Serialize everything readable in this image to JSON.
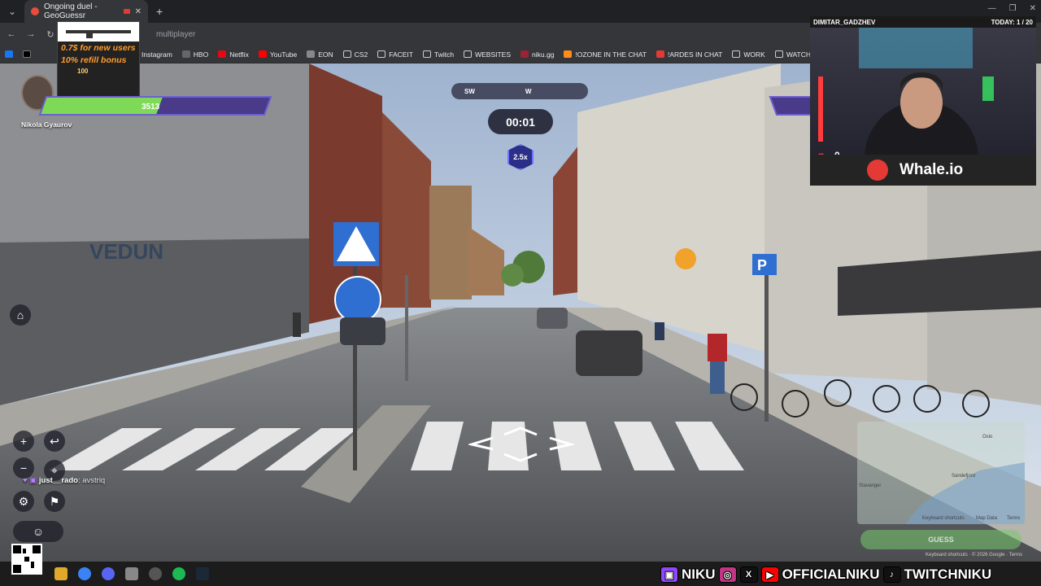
{
  "browser": {
    "tab_title": "Ongoing duel - GeoGuessr",
    "url_fragment": "multiplayer",
    "bookmarks": [
      {
        "label": "Instagram",
        "color": "#c13584"
      },
      {
        "label": "HBO",
        "color": "#666666"
      },
      {
        "label": "Netflix",
        "color": "#e50914"
      },
      {
        "label": "YouTube",
        "color": "#ff0000"
      },
      {
        "label": "EON",
        "color": "#888888"
      },
      {
        "label": "CS2",
        "color": "#cccccc"
      },
      {
        "label": "FACEIT",
        "color": "#cccccc"
      },
      {
        "label": "Twitch",
        "color": "#cccccc"
      },
      {
        "label": "WEBSITES",
        "color": "#cccccc"
      },
      {
        "label": "niku.gg",
        "color": "#9b2335"
      },
      {
        "label": "!OZONE IN THE CHAT",
        "color": "#ff8c1a"
      },
      {
        "label": "!ARDES IN CHAT",
        "color": "#e53935"
      },
      {
        "label": "WORK",
        "color": "#cccccc"
      },
      {
        "label": "WATCH LATER",
        "color": "#cccccc"
      }
    ]
  },
  "promo": {
    "line1": "0.7$ for new users",
    "line2": "10% refill bonus",
    "amount": "100"
  },
  "player": {
    "name": "Nikola Gyaurov",
    "health": "3513",
    "health_fraction": 0.52
  },
  "hud": {
    "compass_left": "SW",
    "compass_right": "W",
    "timer": "00:01",
    "multiplier": "2.5x"
  },
  "chat": {
    "user": "just__rado",
    "message": "avstriq"
  },
  "map": {
    "guess_label": "GUESS",
    "labels": [
      "Oslo",
      "Stavanger",
      "Sandefjord",
      "Keyboard shortcuts",
      "Map Data",
      "Terms"
    ],
    "attribution": "Keyboard shortcuts · © 2026 Google · Terms"
  },
  "webcam": {
    "streamer": "DIMITAR_GADZHEV",
    "today": "TODAY: 1 / 20",
    "count": "0",
    "brand": "Whale.io"
  },
  "socials": {
    "name1": "NIKU",
    "name2": "OFFICIALNIKU",
    "name3": "TWITCHNIKU"
  }
}
